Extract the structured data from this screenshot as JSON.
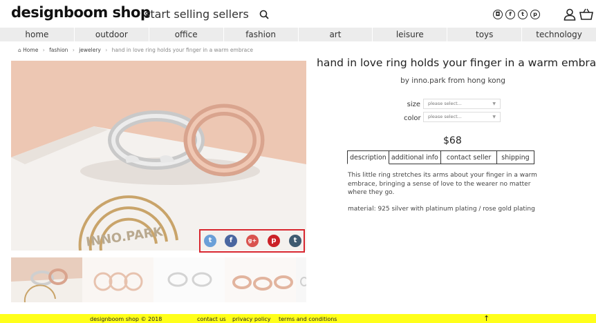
{
  "header": {
    "logo": "designboom shop",
    "nav": [
      "start selling",
      "sellers"
    ],
    "social_icons": [
      "instagram-icon",
      "facebook-icon",
      "twitter-icon",
      "pinterest-icon"
    ]
  },
  "categories": [
    "home",
    "outdoor",
    "office",
    "fashion",
    "art",
    "leisure",
    "toys",
    "technology"
  ],
  "breadcrumb": {
    "home": "Home",
    "items": [
      "fashion",
      "jewelery"
    ],
    "current": "hand in love ring holds your finger in a warm embrace"
  },
  "image": {
    "brand_text": "INNO.PARK"
  },
  "share": [
    "twitter",
    "facebook",
    "google-plus",
    "pinterest",
    "tumblr"
  ],
  "product": {
    "title": "hand in love ring holds your finger in a warm embrace",
    "byline": "by  inno.park from hong kong",
    "size_label": "size",
    "color_label": "color",
    "size_placeholder": "please select...",
    "color_placeholder": "please select...",
    "price": "$68",
    "tabs": [
      "description",
      "additional info",
      "contact seller",
      "shipping"
    ],
    "description": "This little ring stretches its arms about your finger in a warm embrace, bringing a sense of love to the wearer no matter where they go.",
    "material": "material:  925 silver with platinum plating  /  rose gold plating"
  },
  "footer": {
    "copyright": "designboom shop © 2018",
    "links": [
      "contact us",
      "privacy policy",
      "terms and conditions"
    ],
    "up": "↑"
  },
  "colors": {
    "image_bg": "#edc7b3",
    "footer_bg": "#ffff1a",
    "share_border": "#d8262f",
    "nav_bg": "#ececec"
  }
}
